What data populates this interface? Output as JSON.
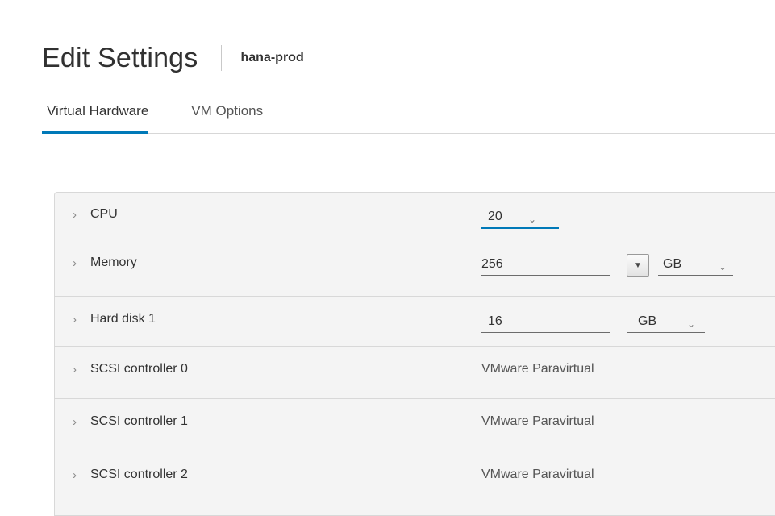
{
  "header": {
    "title": "Edit Settings",
    "vm_name": "hana-prod"
  },
  "tabs": [
    {
      "label": "Virtual Hardware",
      "active": true
    },
    {
      "label": "VM Options",
      "active": false
    }
  ],
  "hardware": {
    "cpu": {
      "label": "CPU",
      "value": "20"
    },
    "memory": {
      "label": "Memory",
      "value": "256",
      "unit": "GB"
    },
    "hard_disk_1": {
      "label": "Hard disk 1",
      "value": "16",
      "unit": "GB"
    },
    "scsi_controllers": [
      {
        "label": "SCSI controller 0",
        "value": "VMware Paravirtual"
      },
      {
        "label": "SCSI controller 1",
        "value": "VMware Paravirtual"
      },
      {
        "label": "SCSI controller 2",
        "value": "VMware Paravirtual"
      }
    ]
  },
  "icons": {
    "expand": "chevron-right-icon",
    "dropdown": "chevron-down-icon",
    "spin": "caret-down-icon"
  },
  "colors": {
    "accent": "#0079b8",
    "panel_bg": "#f4f4f4",
    "border": "#d8d8d8"
  }
}
